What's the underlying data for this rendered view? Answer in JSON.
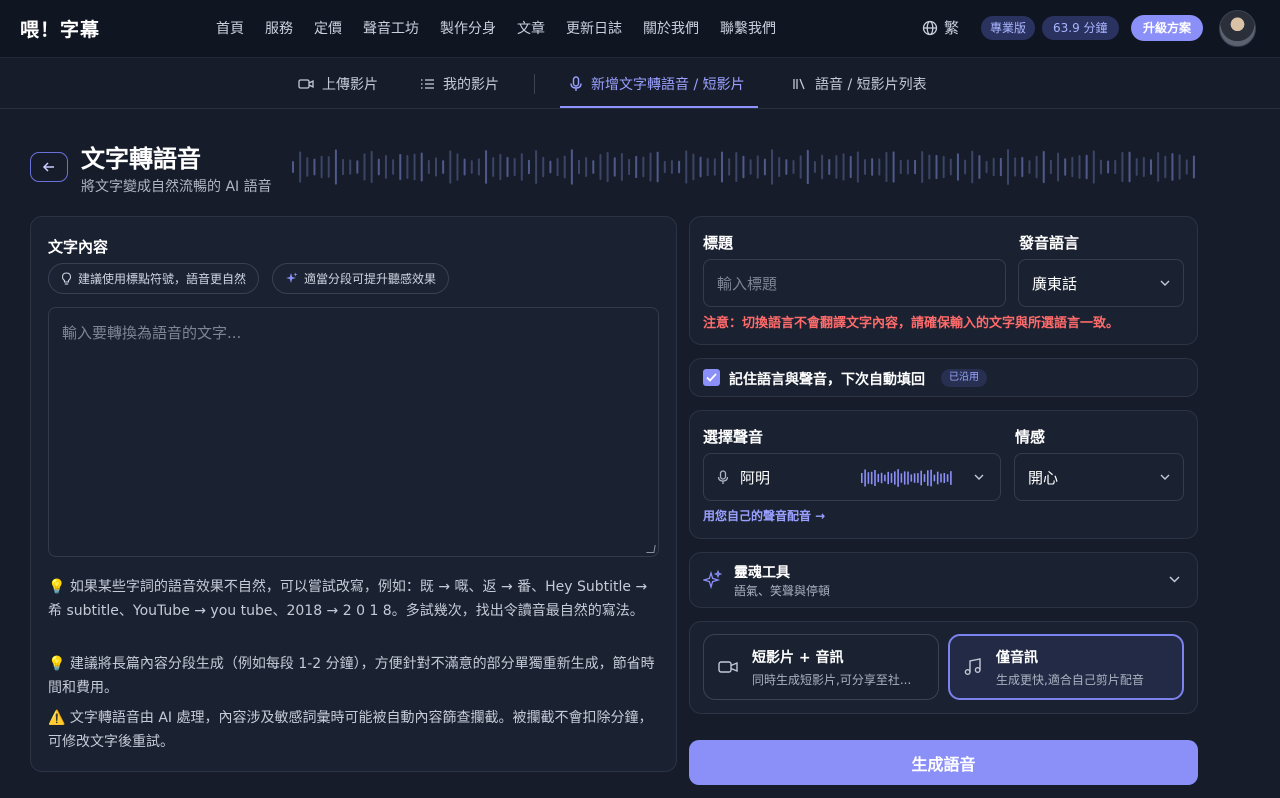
{
  "app": {
    "logo": "喂！字幕"
  },
  "nav": {
    "items": [
      "首頁",
      "服務",
      "定價",
      "聲音工坊",
      "製作分身",
      "文章",
      "更新日誌",
      "關於我們",
      "聯繫我們"
    ],
    "language": "繁",
    "plan_badge": "專業版",
    "minutes_badge": "63.9 分鐘",
    "upgrade_label": "升級方案"
  },
  "subnav": {
    "tabs": [
      "上傳影片",
      "我的影片",
      "新增文字轉語音 / 短影片",
      "語音 / 短影片列表"
    ],
    "active_tab": 2
  },
  "header": {
    "title": "文字轉語音",
    "subtitle": "將文字變成自然流暢的 AI 語音"
  },
  "text_panel": {
    "label": "文字內容",
    "chips": [
      "建議使用標點符號，語音更自然",
      "適當分段可提升聽感效果"
    ],
    "placeholder": "輸入要轉換為語音的文字...",
    "tips": [
      "💡 如果某些字詞的語音效果不自然，可以嘗試改寫，例如：既 → 嘅、返 → 番、Hey Subtitle → 希 subtitle、YouTube → you tube、2018 → 2 0 1 8。多試幾次，找出令讀音最自然的寫法。",
      "💡 建議將長篇內容分段生成（例如每段 1-2 分鐘），方便針對不滿意的部分單獨重新生成，節省時間和費用。",
      "⚠️ 文字轉語音由 AI 處理，內容涉及敏感詞彙時可能被自動內容篩查攔截。被攔截不會扣除分鐘，可修改文字後重試。"
    ]
  },
  "settings": {
    "title_label": "標題",
    "title_placeholder": "輸入標題",
    "language_label": "發音語言",
    "language_value": "廣東話",
    "warning": "注意：切換語言不會翻譯文字內容，請確保輸入的文字與所選語言一致。",
    "remember_label": "記住語言與聲音，下次自動填回",
    "remember_badge": "已沿用",
    "voice_label": "選擇聲音",
    "voice_value": "阿明",
    "emotion_label": "情感",
    "emotion_value": "開心",
    "custom_voice_link": "用您自己的聲音配音 →",
    "soul_title": "靈魂工具",
    "soul_subtitle": "語氣、笑聲與停頓",
    "modes": [
      {
        "title": "短影片 + 音訊",
        "desc": "同時生成短影片,可分享至社..."
      },
      {
        "title": "僅音訊",
        "desc": "生成更快,適合自己剪片配音"
      }
    ],
    "selected_mode": 1,
    "generate_label": "生成語音"
  },
  "colors": {
    "accent": "#8b8ff8",
    "warning": "#ff6b6b",
    "background": "#161c2a"
  },
  "icons": [
    "globe-icon",
    "video-icon",
    "list-icon",
    "mic-icon",
    "library-icon",
    "arrow-left-icon",
    "lightbulb-icon",
    "sparkle-icon",
    "chevron-down-icon",
    "check-icon",
    "music-icon"
  ]
}
